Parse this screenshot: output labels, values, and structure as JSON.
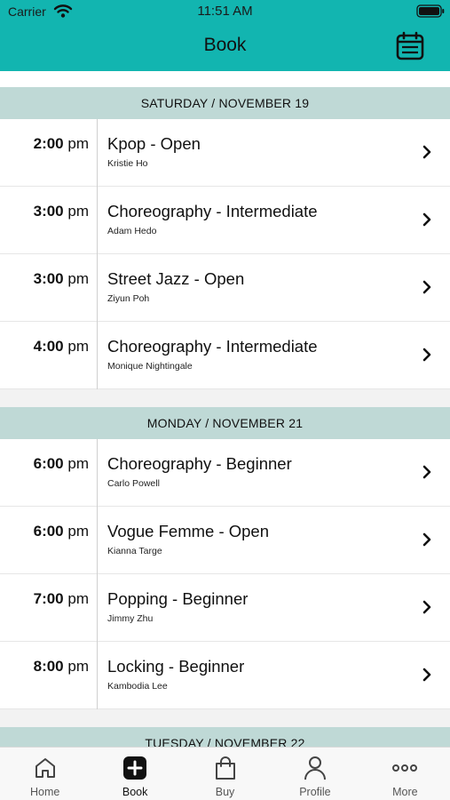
{
  "status_bar": {
    "carrier": "Carrier",
    "time": "11:51 AM"
  },
  "header": {
    "title": "Book"
  },
  "days": [
    {
      "label": "SATURDAY / NOVEMBER 19",
      "classes": [
        {
          "time": "2:00",
          "ampm": "pm",
          "name": "Kpop - Open",
          "teacher": "Kristie Ho"
        },
        {
          "time": "3:00",
          "ampm": "pm",
          "name": "Choreography - Intermediate",
          "teacher": "Adam Hedo"
        },
        {
          "time": "3:00",
          "ampm": "pm",
          "name": "Street Jazz - Open",
          "teacher": "Ziyun Poh"
        },
        {
          "time": "4:00",
          "ampm": "pm",
          "name": "Choreography - Intermediate",
          "teacher": "Monique Nightingale"
        }
      ]
    },
    {
      "label": "MONDAY / NOVEMBER 21",
      "classes": [
        {
          "time": "6:00",
          "ampm": "pm",
          "name": "Choreography - Beginner",
          "teacher": "Carlo Powell"
        },
        {
          "time": "6:00",
          "ampm": "pm",
          "name": "Vogue Femme - Open",
          "teacher": "Kianna Targe"
        },
        {
          "time": "7:00",
          "ampm": "pm",
          "name": "Popping - Beginner",
          "teacher": "Jimmy Zhu"
        },
        {
          "time": "8:00",
          "ampm": "pm",
          "name": "Locking - Beginner",
          "teacher": "Kambodia Lee"
        }
      ]
    },
    {
      "label": "TUESDAY / NOVEMBER 22",
      "classes": []
    }
  ],
  "tabs": [
    {
      "label": "Home",
      "icon": "home-icon"
    },
    {
      "label": "Book",
      "icon": "plus-square-icon",
      "active": true
    },
    {
      "label": "Buy",
      "icon": "bag-icon"
    },
    {
      "label": "Profile",
      "icon": "person-icon"
    },
    {
      "label": "More",
      "icon": "more-dots-icon"
    }
  ],
  "colors": {
    "accent": "#12b5b0",
    "day_header": "#bfd9d6"
  }
}
